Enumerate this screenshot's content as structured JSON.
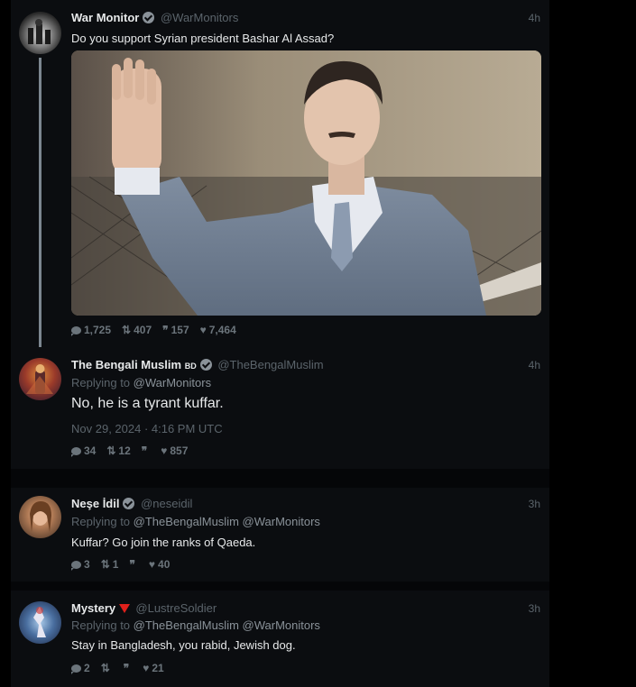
{
  "tweets": [
    {
      "name": "War Monitor",
      "handle": "@WarMonitors",
      "time": "4h",
      "text": "Do you support Syrian president Bashar Al Assad?",
      "stats": {
        "replies": "1,725",
        "retweets": "407",
        "quotes": "157",
        "likes": "7,464"
      },
      "image_description_icon": "photo"
    },
    {
      "name": "The Bengali Muslim",
      "name_suffix": "BD",
      "handle": "@TheBengalMuslim",
      "time": "4h",
      "replying_prefix": "Replying to",
      "replying_to": "@WarMonitors",
      "text": "No, he is a tyrant kuffar.",
      "date": "Nov 29, 2024 · 4:16 PM UTC",
      "stats": {
        "replies": "34",
        "retweets": "12",
        "quotes": "",
        "likes": "857"
      }
    },
    {
      "name": "Neşe İdil",
      "handle": "@neseidil",
      "time": "3h",
      "replying_prefix": "Replying to",
      "replying_to": "@TheBengalMuslim @WarMonitors",
      "text": "Kuffar? Go join the ranks of Qaeda.",
      "stats": {
        "replies": "3",
        "retweets": "1",
        "quotes": "",
        "likes": "40"
      }
    },
    {
      "name": "Mystery",
      "handle": "@LustreSoldier",
      "time": "3h",
      "replying_prefix": "Replying to",
      "replying_to": "@TheBengalMuslim @WarMonitors",
      "text": "Stay in Bangladesh, you rabid, Jewish dog.",
      "stats": {
        "replies": "2",
        "retweets": "",
        "quotes": "",
        "likes": "21"
      }
    }
  ],
  "colors": {
    "background": "#000000",
    "tweet_bg": "#0b0d10",
    "muted": "#5b646b",
    "text": "#e7e9ea",
    "flag_red": "#e0201b"
  },
  "icons": [
    "reply-bubble-icon",
    "retweet-icon",
    "quote-icon",
    "heart-icon",
    "verified-badge-icon"
  ]
}
